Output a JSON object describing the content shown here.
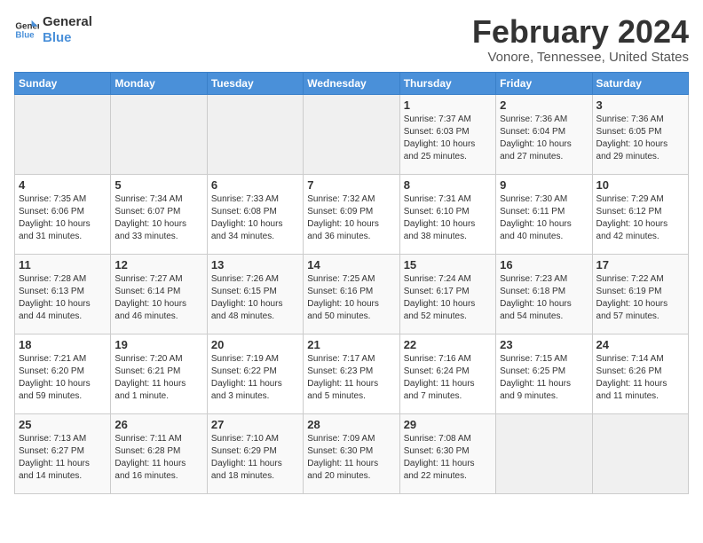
{
  "logo": {
    "line1": "General",
    "line2": "Blue"
  },
  "title": "February 2024",
  "location": "Vonore, Tennessee, United States",
  "days_of_week": [
    "Sunday",
    "Monday",
    "Tuesday",
    "Wednesday",
    "Thursday",
    "Friday",
    "Saturday"
  ],
  "weeks": [
    [
      {
        "day": "",
        "info": ""
      },
      {
        "day": "",
        "info": ""
      },
      {
        "day": "",
        "info": ""
      },
      {
        "day": "",
        "info": ""
      },
      {
        "day": "1",
        "info": "Sunrise: 7:37 AM\nSunset: 6:03 PM\nDaylight: 10 hours\nand 25 minutes."
      },
      {
        "day": "2",
        "info": "Sunrise: 7:36 AM\nSunset: 6:04 PM\nDaylight: 10 hours\nand 27 minutes."
      },
      {
        "day": "3",
        "info": "Sunrise: 7:36 AM\nSunset: 6:05 PM\nDaylight: 10 hours\nand 29 minutes."
      }
    ],
    [
      {
        "day": "4",
        "info": "Sunrise: 7:35 AM\nSunset: 6:06 PM\nDaylight: 10 hours\nand 31 minutes."
      },
      {
        "day": "5",
        "info": "Sunrise: 7:34 AM\nSunset: 6:07 PM\nDaylight: 10 hours\nand 33 minutes."
      },
      {
        "day": "6",
        "info": "Sunrise: 7:33 AM\nSunset: 6:08 PM\nDaylight: 10 hours\nand 34 minutes."
      },
      {
        "day": "7",
        "info": "Sunrise: 7:32 AM\nSunset: 6:09 PM\nDaylight: 10 hours\nand 36 minutes."
      },
      {
        "day": "8",
        "info": "Sunrise: 7:31 AM\nSunset: 6:10 PM\nDaylight: 10 hours\nand 38 minutes."
      },
      {
        "day": "9",
        "info": "Sunrise: 7:30 AM\nSunset: 6:11 PM\nDaylight: 10 hours\nand 40 minutes."
      },
      {
        "day": "10",
        "info": "Sunrise: 7:29 AM\nSunset: 6:12 PM\nDaylight: 10 hours\nand 42 minutes."
      }
    ],
    [
      {
        "day": "11",
        "info": "Sunrise: 7:28 AM\nSunset: 6:13 PM\nDaylight: 10 hours\nand 44 minutes."
      },
      {
        "day": "12",
        "info": "Sunrise: 7:27 AM\nSunset: 6:14 PM\nDaylight: 10 hours\nand 46 minutes."
      },
      {
        "day": "13",
        "info": "Sunrise: 7:26 AM\nSunset: 6:15 PM\nDaylight: 10 hours\nand 48 minutes."
      },
      {
        "day": "14",
        "info": "Sunrise: 7:25 AM\nSunset: 6:16 PM\nDaylight: 10 hours\nand 50 minutes."
      },
      {
        "day": "15",
        "info": "Sunrise: 7:24 AM\nSunset: 6:17 PM\nDaylight: 10 hours\nand 52 minutes."
      },
      {
        "day": "16",
        "info": "Sunrise: 7:23 AM\nSunset: 6:18 PM\nDaylight: 10 hours\nand 54 minutes."
      },
      {
        "day": "17",
        "info": "Sunrise: 7:22 AM\nSunset: 6:19 PM\nDaylight: 10 hours\nand 57 minutes."
      }
    ],
    [
      {
        "day": "18",
        "info": "Sunrise: 7:21 AM\nSunset: 6:20 PM\nDaylight: 10 hours\nand 59 minutes."
      },
      {
        "day": "19",
        "info": "Sunrise: 7:20 AM\nSunset: 6:21 PM\nDaylight: 11 hours\nand 1 minute."
      },
      {
        "day": "20",
        "info": "Sunrise: 7:19 AM\nSunset: 6:22 PM\nDaylight: 11 hours\nand 3 minutes."
      },
      {
        "day": "21",
        "info": "Sunrise: 7:17 AM\nSunset: 6:23 PM\nDaylight: 11 hours\nand 5 minutes."
      },
      {
        "day": "22",
        "info": "Sunrise: 7:16 AM\nSunset: 6:24 PM\nDaylight: 11 hours\nand 7 minutes."
      },
      {
        "day": "23",
        "info": "Sunrise: 7:15 AM\nSunset: 6:25 PM\nDaylight: 11 hours\nand 9 minutes."
      },
      {
        "day": "24",
        "info": "Sunrise: 7:14 AM\nSunset: 6:26 PM\nDaylight: 11 hours\nand 11 minutes."
      }
    ],
    [
      {
        "day": "25",
        "info": "Sunrise: 7:13 AM\nSunset: 6:27 PM\nDaylight: 11 hours\nand 14 minutes."
      },
      {
        "day": "26",
        "info": "Sunrise: 7:11 AM\nSunset: 6:28 PM\nDaylight: 11 hours\nand 16 minutes."
      },
      {
        "day": "27",
        "info": "Sunrise: 7:10 AM\nSunset: 6:29 PM\nDaylight: 11 hours\nand 18 minutes."
      },
      {
        "day": "28",
        "info": "Sunrise: 7:09 AM\nSunset: 6:30 PM\nDaylight: 11 hours\nand 20 minutes."
      },
      {
        "day": "29",
        "info": "Sunrise: 7:08 AM\nSunset: 6:30 PM\nDaylight: 11 hours\nand 22 minutes."
      },
      {
        "day": "",
        "info": ""
      },
      {
        "day": "",
        "info": ""
      }
    ]
  ]
}
